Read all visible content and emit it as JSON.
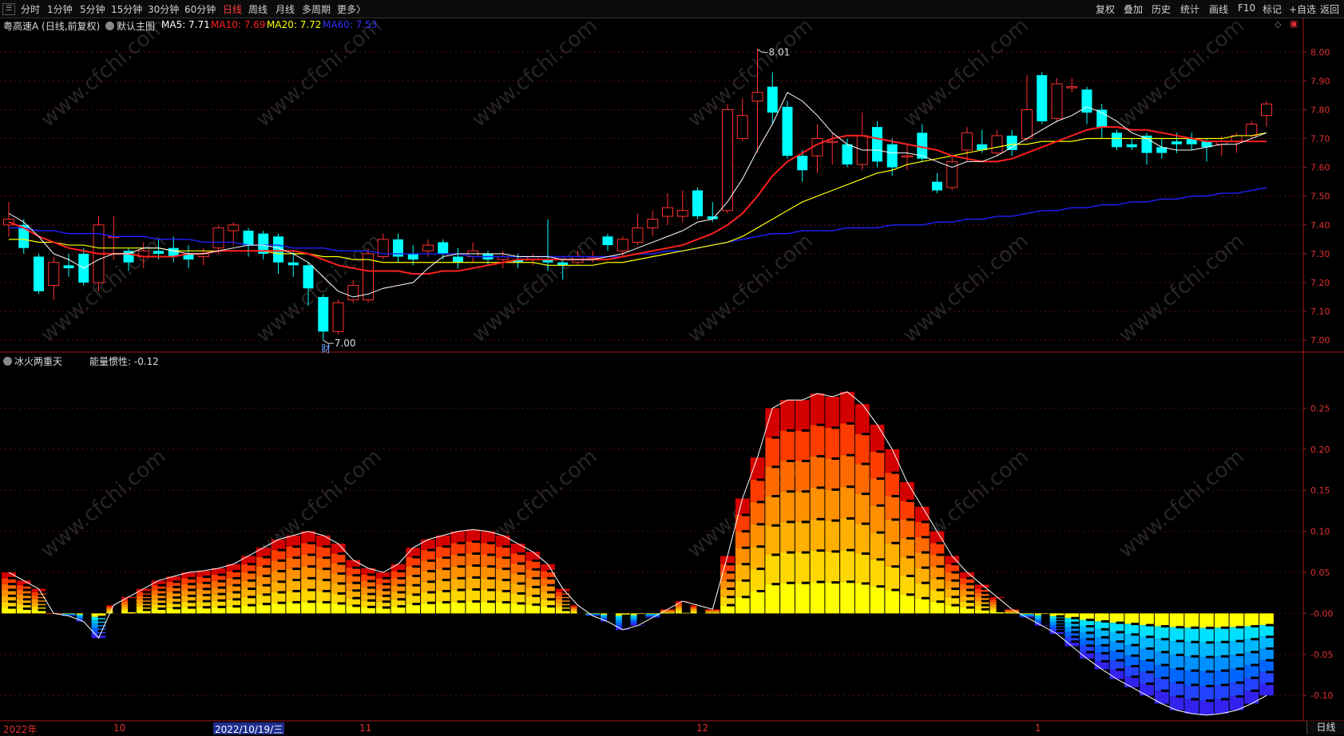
{
  "toolbar": {
    "menu_icon": "menu-icon",
    "periods": [
      "分时",
      "1分钟",
      "5分钟",
      "15分钟",
      "30分钟",
      "60分钟",
      "日线",
      "周线",
      "月线",
      "多周期",
      "更多"
    ],
    "more_suffix": "〉",
    "active_period": "日线",
    "right_buttons": [
      "复权",
      "叠加",
      "历史",
      "统计",
      "画线",
      "F10",
      "标记",
      "+自选",
      "返回"
    ]
  },
  "main_chart": {
    "stock_title": "粤高速A (日线,前复权)",
    "template": "默认主图",
    "ma5": "MA5: 7.71",
    "ma10": "MA10: 7.69",
    "ma20": "MA20: 7.72",
    "ma60": "MA60: 7.53",
    "high_marker": "8.01",
    "low_marker": "7.00",
    "event_tag": "财",
    "y_ticks": [
      "8.00",
      "7.90",
      "7.80",
      "7.70",
      "7.60",
      "7.50",
      "7.40",
      "7.30",
      "7.20",
      "7.10",
      "7.00"
    ],
    "colors": {
      "up": "#ff3030",
      "down": "#00ffff",
      "ma5": "#ffffff",
      "ma10": "#ff2020",
      "ma20": "#ffff00",
      "ma60": "#2020ff"
    }
  },
  "indicator": {
    "name": "冰火两重天",
    "value_label": "能量惯性: -0.12",
    "y_ticks": [
      "0.25",
      "0.20",
      "0.15",
      "0.10",
      "0.05",
      "-0.00",
      "-0.05",
      "-0.10"
    ]
  },
  "date_axis": {
    "labels": [
      "2022年",
      "10",
      "11",
      "12",
      "1"
    ],
    "highlight": "2022/10/19/三",
    "period_button": "日线"
  },
  "watermark": "www.cfchi.com",
  "chart_data": [
    {
      "type": "candlestick",
      "title": "粤高速A (日线,前复权)",
      "ylim": [
        6.97,
        8.07
      ],
      "candles": [
        {
          "o": 7.4,
          "c": 7.42,
          "h": 7.48,
          "l": 7.36
        },
        {
          "o": 7.4,
          "c": 7.32,
          "h": 7.42,
          "l": 7.3
        },
        {
          "o": 7.29,
          "c": 7.17,
          "h": 7.3,
          "l": 7.16
        },
        {
          "o": 7.19,
          "c": 7.27,
          "h": 7.29,
          "l": 7.14
        },
        {
          "o": 7.26,
          "c": 7.25,
          "h": 7.3,
          "l": 7.22
        },
        {
          "o": 7.3,
          "c": 7.2,
          "h": 7.32,
          "l": 7.19
        },
        {
          "o": 7.2,
          "c": 7.4,
          "h": 7.43,
          "l": 7.17
        },
        {
          "o": 7.36,
          "c": 7.36,
          "h": 7.43,
          "l": 7.28
        },
        {
          "o": 7.31,
          "c": 7.27,
          "h": 7.32,
          "l": 7.24
        },
        {
          "o": 7.29,
          "c": 7.31,
          "h": 7.34,
          "l": 7.25
        },
        {
          "o": 7.31,
          "c": 7.3,
          "h": 7.35,
          "l": 7.28
        },
        {
          "o": 7.32,
          "c": 7.29,
          "h": 7.36,
          "l": 7.27
        },
        {
          "o": 7.3,
          "c": 7.28,
          "h": 7.33,
          "l": 7.25
        },
        {
          "o": 7.29,
          "c": 7.3,
          "h": 7.32,
          "l": 7.26
        },
        {
          "o": 7.32,
          "c": 7.39,
          "h": 7.4,
          "l": 7.3
        },
        {
          "o": 7.38,
          "c": 7.4,
          "h": 7.41,
          "l": 7.33
        },
        {
          "o": 7.38,
          "c": 7.33,
          "h": 7.39,
          "l": 7.29
        },
        {
          "o": 7.37,
          "c": 7.3,
          "h": 7.38,
          "l": 7.28
        },
        {
          "o": 7.36,
          "c": 7.27,
          "h": 7.37,
          "l": 7.23
        },
        {
          "o": 7.27,
          "c": 7.26,
          "h": 7.31,
          "l": 7.22
        },
        {
          "o": 7.26,
          "c": 7.18,
          "h": 7.27,
          "l": 7.12
        },
        {
          "o": 7.15,
          "c": 7.03,
          "h": 7.16,
          "l": 7.0
        },
        {
          "o": 7.03,
          "c": 7.13,
          "h": 7.14,
          "l": 7.02
        },
        {
          "o": 7.14,
          "c": 7.19,
          "h": 7.21,
          "l": 7.13
        },
        {
          "o": 7.14,
          "c": 7.3,
          "h": 7.32,
          "l": 7.13
        },
        {
          "o": 7.29,
          "c": 7.35,
          "h": 7.37,
          "l": 7.28
        },
        {
          "o": 7.35,
          "c": 7.29,
          "h": 7.37,
          "l": 7.27
        },
        {
          "o": 7.3,
          "c": 7.28,
          "h": 7.33,
          "l": 7.26
        },
        {
          "o": 7.31,
          "c": 7.33,
          "h": 7.35,
          "l": 7.29
        },
        {
          "o": 7.34,
          "c": 7.3,
          "h": 7.35,
          "l": 7.28
        },
        {
          "o": 7.29,
          "c": 7.27,
          "h": 7.32,
          "l": 7.25
        },
        {
          "o": 7.29,
          "c": 7.31,
          "h": 7.34,
          "l": 7.27
        },
        {
          "o": 7.3,
          "c": 7.28,
          "h": 7.31,
          "l": 7.26
        },
        {
          "o": 7.28,
          "c": 7.29,
          "h": 7.31,
          "l": 7.25
        },
        {
          "o": 7.28,
          "c": 7.27,
          "h": 7.3,
          "l": 7.25
        },
        {
          "o": 7.28,
          "c": 7.29,
          "h": 7.3,
          "l": 7.26
        },
        {
          "o": 7.28,
          "c": 7.27,
          "h": 7.42,
          "l": 7.24
        },
        {
          "o": 7.27,
          "c": 7.26,
          "h": 7.28,
          "l": 7.21
        },
        {
          "o": 7.27,
          "c": 7.29,
          "h": 7.31,
          "l": 7.26
        },
        {
          "o": 7.29,
          "c": 7.29,
          "h": 7.31,
          "l": 7.27
        },
        {
          "o": 7.36,
          "c": 7.33,
          "h": 7.37,
          "l": 7.31
        },
        {
          "o": 7.31,
          "c": 7.35,
          "h": 7.36,
          "l": 7.29
        },
        {
          "o": 7.34,
          "c": 7.39,
          "h": 7.44,
          "l": 7.33
        },
        {
          "o": 7.39,
          "c": 7.42,
          "h": 7.45,
          "l": 7.36
        },
        {
          "o": 7.43,
          "c": 7.46,
          "h": 7.51,
          "l": 7.4
        },
        {
          "o": 7.43,
          "c": 7.45,
          "h": 7.52,
          "l": 7.41
        },
        {
          "o": 7.52,
          "c": 7.43,
          "h": 7.53,
          "l": 7.42
        },
        {
          "o": 7.43,
          "c": 7.42,
          "h": 7.48,
          "l": 7.41
        },
        {
          "o": 7.45,
          "c": 7.8,
          "h": 7.82,
          "l": 7.44
        },
        {
          "o": 7.7,
          "c": 7.78,
          "h": 7.84,
          "l": 7.69
        },
        {
          "o": 7.83,
          "c": 7.86,
          "h": 8.01,
          "l": 7.65
        },
        {
          "o": 7.88,
          "c": 7.79,
          "h": 7.93,
          "l": 7.75
        },
        {
          "o": 7.81,
          "c": 7.64,
          "h": 7.83,
          "l": 7.63
        },
        {
          "o": 7.64,
          "c": 7.59,
          "h": 7.66,
          "l": 7.55
        },
        {
          "o": 7.64,
          "c": 7.7,
          "h": 7.75,
          "l": 7.58
        },
        {
          "o": 7.69,
          "c": 7.69,
          "h": 7.72,
          "l": 7.61
        },
        {
          "o": 7.68,
          "c": 7.61,
          "h": 7.7,
          "l": 7.6
        },
        {
          "o": 7.61,
          "c": 7.71,
          "h": 7.79,
          "l": 7.59
        },
        {
          "o": 7.74,
          "c": 7.62,
          "h": 7.76,
          "l": 7.6
        },
        {
          "o": 7.68,
          "c": 7.6,
          "h": 7.7,
          "l": 7.57
        },
        {
          "o": 7.64,
          "c": 7.64,
          "h": 7.68,
          "l": 7.59
        },
        {
          "o": 7.72,
          "c": 7.63,
          "h": 7.75,
          "l": 7.62
        },
        {
          "o": 7.55,
          "c": 7.52,
          "h": 7.58,
          "l": 7.51
        },
        {
          "o": 7.53,
          "c": 7.62,
          "h": 7.64,
          "l": 7.52
        },
        {
          "o": 7.66,
          "c": 7.72,
          "h": 7.74,
          "l": 7.62
        },
        {
          "o": 7.68,
          "c": 7.66,
          "h": 7.73,
          "l": 7.65
        },
        {
          "o": 7.65,
          "c": 7.71,
          "h": 7.73,
          "l": 7.64
        },
        {
          "o": 7.71,
          "c": 7.66,
          "h": 7.73,
          "l": 7.64
        },
        {
          "o": 7.7,
          "c": 7.8,
          "h": 7.92,
          "l": 7.69
        },
        {
          "o": 7.92,
          "c": 7.76,
          "h": 7.93,
          "l": 7.75
        },
        {
          "o": 7.77,
          "c": 7.89,
          "h": 7.91,
          "l": 7.76
        },
        {
          "o": 7.88,
          "c": 7.88,
          "h": 7.91,
          "l": 7.86
        },
        {
          "o": 7.87,
          "c": 7.79,
          "h": 7.88,
          "l": 7.75
        },
        {
          "o": 7.8,
          "c": 7.74,
          "h": 7.82,
          "l": 7.7
        },
        {
          "o": 7.72,
          "c": 7.67,
          "h": 7.73,
          "l": 7.66
        },
        {
          "o": 7.68,
          "c": 7.67,
          "h": 7.7,
          "l": 7.66
        },
        {
          "o": 7.71,
          "c": 7.65,
          "h": 7.72,
          "l": 7.61
        },
        {
          "o": 7.67,
          "c": 7.65,
          "h": 7.7,
          "l": 7.63
        },
        {
          "o": 7.69,
          "c": 7.68,
          "h": 7.72,
          "l": 7.65
        },
        {
          "o": 7.7,
          "c": 7.68,
          "h": 7.72,
          "l": 7.66
        },
        {
          "o": 7.69,
          "c": 7.67,
          "h": 7.7,
          "l": 7.62
        },
        {
          "o": 7.68,
          "c": 7.69,
          "h": 7.71,
          "l": 7.64
        },
        {
          "o": 7.69,
          "c": 7.71,
          "h": 7.72,
          "l": 7.65
        },
        {
          "o": 7.71,
          "c": 7.75,
          "h": 7.76,
          "l": 7.7
        },
        {
          "o": 7.78,
          "c": 7.82,
          "h": 7.83,
          "l": 7.74
        }
      ],
      "ma5": [
        7.44,
        7.41,
        7.36,
        7.3,
        7.28,
        7.25,
        7.28,
        7.3,
        7.3,
        7.32,
        7.32,
        7.31,
        7.3,
        7.3,
        7.31,
        7.32,
        7.33,
        7.33,
        7.32,
        7.3,
        7.27,
        7.22,
        7.17,
        7.15,
        7.16,
        7.18,
        7.19,
        7.2,
        7.25,
        7.29,
        7.3,
        7.3,
        7.3,
        7.3,
        7.29,
        7.29,
        7.29,
        7.28,
        7.28,
        7.28,
        7.29,
        7.3,
        7.32,
        7.34,
        7.36,
        7.38,
        7.41,
        7.42,
        7.48,
        7.56,
        7.66,
        7.75,
        7.86,
        7.83,
        7.78,
        7.72,
        7.68,
        7.66,
        7.66,
        7.65,
        7.65,
        7.64,
        7.62,
        7.6,
        7.62,
        7.62,
        7.64,
        7.67,
        7.7,
        7.73,
        7.76,
        7.78,
        7.81,
        7.79,
        7.76,
        7.72,
        7.7,
        7.67,
        7.66,
        7.66,
        7.67,
        7.68,
        7.68,
        7.7,
        7.72
      ],
      "ma10": [
        7.41,
        7.39,
        7.36,
        7.34,
        7.32,
        7.31,
        7.3,
        7.3,
        7.3,
        7.29,
        7.29,
        7.29,
        7.3,
        7.3,
        7.31,
        7.31,
        7.31,
        7.31,
        7.31,
        7.31,
        7.3,
        7.28,
        7.26,
        7.25,
        7.24,
        7.24,
        7.24,
        7.23,
        7.23,
        7.24,
        7.24,
        7.25,
        7.26,
        7.27,
        7.28,
        7.28,
        7.28,
        7.28,
        7.28,
        7.28,
        7.28,
        7.29,
        7.3,
        7.31,
        7.32,
        7.33,
        7.35,
        7.37,
        7.4,
        7.44,
        7.5,
        7.57,
        7.62,
        7.65,
        7.68,
        7.7,
        7.71,
        7.71,
        7.7,
        7.69,
        7.68,
        7.67,
        7.66,
        7.64,
        7.63,
        7.62,
        7.62,
        7.63,
        7.65,
        7.67,
        7.69,
        7.71,
        7.73,
        7.74,
        7.74,
        7.73,
        7.73,
        7.72,
        7.71,
        7.7,
        7.69,
        7.69,
        7.69,
        7.69,
        7.69
      ],
      "ma20": [
        7.35,
        7.35,
        7.34,
        7.34,
        7.33,
        7.33,
        7.32,
        7.32,
        7.32,
        7.32,
        7.32,
        7.31,
        7.31,
        7.31,
        7.31,
        7.31,
        7.31,
        7.31,
        7.3,
        7.3,
        7.3,
        7.29,
        7.29,
        7.28,
        7.28,
        7.27,
        7.27,
        7.27,
        7.27,
        7.27,
        7.27,
        7.27,
        7.27,
        7.27,
        7.27,
        7.27,
        7.26,
        7.26,
        7.26,
        7.26,
        7.27,
        7.27,
        7.28,
        7.29,
        7.3,
        7.31,
        7.32,
        7.33,
        7.34,
        7.36,
        7.39,
        7.42,
        7.45,
        7.48,
        7.5,
        7.52,
        7.54,
        7.56,
        7.58,
        7.59,
        7.61,
        7.62,
        7.63,
        7.64,
        7.65,
        7.66,
        7.67,
        7.68,
        7.68,
        7.69,
        7.69,
        7.69,
        7.7,
        7.7,
        7.7,
        7.7,
        7.7,
        7.7,
        7.7,
        7.7,
        7.7,
        7.7,
        7.71,
        7.71,
        7.72
      ],
      "ma60": [
        7.39,
        7.39,
        7.38,
        7.38,
        7.37,
        7.37,
        7.37,
        7.36,
        7.36,
        7.36,
        7.35,
        7.35,
        7.35,
        7.34,
        7.34,
        7.34,
        7.33,
        7.33,
        7.33,
        7.32,
        7.32,
        7.32,
        7.31,
        7.31,
        7.31,
        7.3,
        7.3,
        7.3,
        7.3,
        7.3,
        7.3,
        7.29,
        7.29,
        7.29,
        7.29,
        7.29,
        7.29,
        7.29,
        7.29,
        7.29,
        7.29,
        7.29,
        7.3,
        7.3,
        7.31,
        7.31,
        7.32,
        7.33,
        7.34,
        7.35,
        7.36,
        7.37,
        7.37,
        7.38,
        7.38,
        7.38,
        7.39,
        7.39,
        7.39,
        7.4,
        7.4,
        7.4,
        7.41,
        7.41,
        7.42,
        7.42,
        7.43,
        7.43,
        7.44,
        7.45,
        7.45,
        7.46,
        7.46,
        7.47,
        7.47,
        7.48,
        7.48,
        7.49,
        7.49,
        7.5,
        7.5,
        7.51,
        7.51,
        7.52,
        7.53
      ]
    },
    {
      "type": "bar",
      "title": "冰火两重天",
      "ylim": [
        -0.128,
        0.3
      ],
      "values": [
        0.05,
        0.04,
        0.03,
        0.0,
        -0.003,
        -0.01,
        -0.03,
        0.01,
        0.02,
        0.03,
        0.04,
        0.045,
        0.05,
        0.052,
        0.055,
        0.06,
        0.07,
        0.08,
        0.09,
        0.095,
        0.1,
        0.095,
        0.085,
        0.065,
        0.055,
        0.05,
        0.06,
        0.08,
        0.09,
        0.095,
        0.1,
        0.102,
        0.1,
        0.095,
        0.085,
        0.075,
        0.06,
        0.03,
        0.01,
        -0.003,
        -0.01,
        -0.02,
        -0.015,
        -0.005,
        0.005,
        0.015,
        0.01,
        0.005,
        0.07,
        0.14,
        0.19,
        0.25,
        0.26,
        0.26,
        0.268,
        0.264,
        0.27,
        0.255,
        0.23,
        0.2,
        0.16,
        0.13,
        0.1,
        0.07,
        0.05,
        0.035,
        0.02,
        0.005,
        -0.005,
        -0.015,
        -0.025,
        -0.04,
        -0.055,
        -0.068,
        -0.08,
        -0.09,
        -0.1,
        -0.11,
        -0.118,
        -0.122,
        -0.124,
        -0.122,
        -0.118,
        -0.11,
        -0.1
      ]
    }
  ]
}
